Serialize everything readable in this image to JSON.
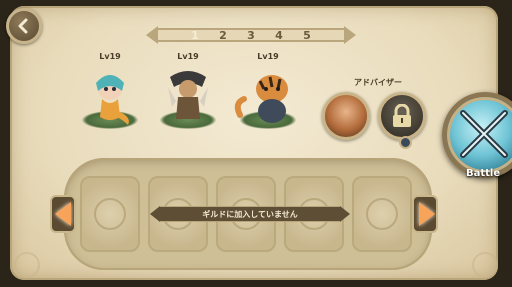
{
  "header": {
    "back_icon": "chevron-left-icon"
  },
  "pager": {
    "pages": [
      "1",
      "2",
      "3",
      "4",
      "5"
    ],
    "active_index": 0
  },
  "party": {
    "heroes": [
      {
        "level": "Lv19",
        "name_hint": "mermaid-hero",
        "color": "#4fb2b6"
      },
      {
        "level": "Lv19",
        "name_hint": "bird-warrior-hero",
        "color": "#4d6a5f"
      },
      {
        "level": "Lv19",
        "name_hint": "tiger-hero",
        "color": "#d98c3e"
      }
    ],
    "advisor_label": "アドバイザー",
    "advisor_lock_icon": "lock-icon"
  },
  "battle": {
    "label": "Battle",
    "icon": "crossed-swords-icon"
  },
  "guild": {
    "status_text": "ギルドに加入していません"
  },
  "colors": {
    "accent": "#f7a35a",
    "parchment": "#ede2c6",
    "battle": "#6fc4d5"
  }
}
